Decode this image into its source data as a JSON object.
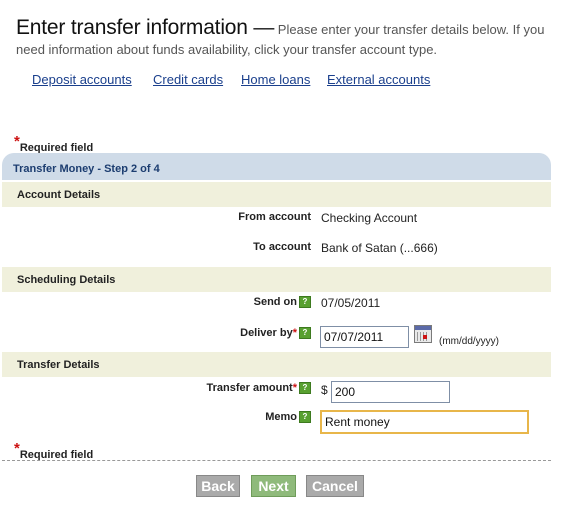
{
  "header": {
    "title": "Enter transfer information —",
    "subtitle": "Please enter your transfer details below. If you need information about funds availability, click your transfer account type."
  },
  "nav": {
    "links": [
      "Deposit accounts",
      "Credit cards",
      "Home loans",
      "External accounts"
    ]
  },
  "required_note": "Required field",
  "step": "Transfer Money - Step 2 of 4",
  "account_details": {
    "heading": "Account Details",
    "from_label": "From account",
    "from_value": "Checking Account",
    "to_label": "To account",
    "to_value": "Bank of Satan (...666)"
  },
  "scheduling": {
    "heading": "Scheduling Details",
    "send_on_label": "Send on",
    "send_on_value": "07/05/2011",
    "deliver_by_label": "Deliver by",
    "deliver_by_value": "07/07/2011",
    "date_format": "(mm/dd/yyyy)"
  },
  "transfer": {
    "heading": "Transfer Details",
    "amount_label": "Transfer amount",
    "currency": "$",
    "amount_value": "200",
    "memo_label": "Memo",
    "memo_value": "Rent money"
  },
  "help_icon": "?",
  "buttons": {
    "back": "Back",
    "next": "Next",
    "cancel": "Cancel"
  },
  "colors": {
    "accent": "#1c3d70",
    "next_button": "#8fba7b",
    "help_icon": "#58a030",
    "required_star": "#cc1111"
  }
}
